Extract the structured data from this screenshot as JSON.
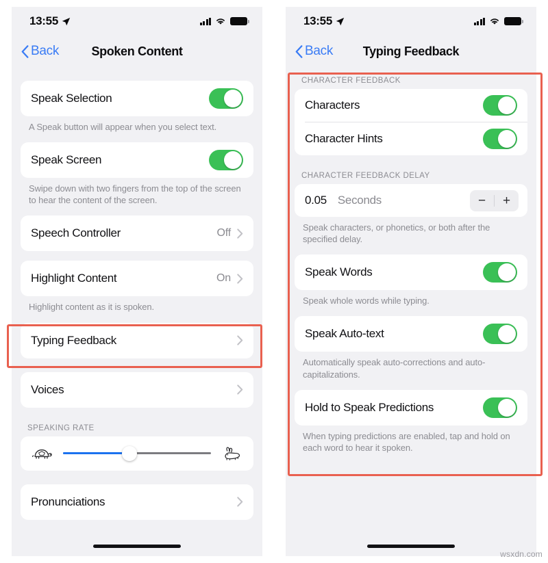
{
  "watermark": "wsxdn.com",
  "left_screen": {
    "status_bar": {
      "time": "13:55",
      "location_icon": "location-arrow-icon",
      "signal_icon": "cellular-signal-icon",
      "wifi_icon": "wifi-icon",
      "battery_icon": "battery-full-icon"
    },
    "nav": {
      "back_label": "Back",
      "title": "Spoken Content",
      "back_icon": "chevron-left-icon"
    },
    "rows": [
      {
        "type": "toggle",
        "label": "Speak Selection",
        "state": "on",
        "footnote": "A Speak button will appear when you select text."
      },
      {
        "type": "toggle",
        "label": "Speak Screen",
        "state": "on",
        "footnote": "Swipe down with two fingers from the top of the screen to hear the content of the screen."
      },
      {
        "type": "link",
        "label": "Speech Controller",
        "value": "Off",
        "footnote": ""
      },
      {
        "type": "link",
        "label": "Highlight Content",
        "value": "On",
        "footnote": "Highlight content as it is spoken."
      },
      {
        "type": "link",
        "label": "Typing Feedback",
        "value": "",
        "footnote": "",
        "highlighted": true
      },
      {
        "type": "link",
        "label": "Voices",
        "value": "",
        "footnote": ""
      }
    ],
    "speaking_rate": {
      "header": "SPEAKING RATE",
      "slow_icon": "turtle-icon",
      "fast_icon": "rabbit-icon",
      "value_percent": 45
    },
    "pronunciations": {
      "label": "Pronunciations"
    }
  },
  "right_screen": {
    "status_bar": {
      "time": "13:55",
      "location_icon": "location-arrow-icon",
      "signal_icon": "cellular-signal-icon",
      "wifi_icon": "wifi-icon",
      "battery_icon": "battery-full-icon"
    },
    "nav": {
      "back_label": "Back",
      "title": "Typing Feedback",
      "back_icon": "chevron-left-icon"
    },
    "character_feedback": {
      "header": "CHARACTER FEEDBACK",
      "rows": [
        {
          "label": "Characters",
          "state": "on"
        },
        {
          "label": "Character Hints",
          "state": "on"
        }
      ]
    },
    "character_feedback_delay": {
      "header": "CHARACTER FEEDBACK DELAY",
      "value": "0.05",
      "unit": "Seconds",
      "minus_label": "−",
      "plus_label": "+",
      "footnote": "Speak characters, or phonetics, or both after the specified delay."
    },
    "speak_words": {
      "label": "Speak Words",
      "state": "on",
      "footnote": "Speak whole words while typing."
    },
    "speak_auto_text": {
      "label": "Speak Auto-text",
      "state": "on",
      "footnote": "Automatically speak auto-corrections and auto-capitalizations."
    },
    "hold_to_speak": {
      "label": "Hold to Speak Predictions",
      "state": "on",
      "footnote": "When typing predictions are enabled, tap and hold on each word to hear it spoken."
    }
  },
  "colors": {
    "toggle_on": "#3ac056",
    "accent_blue": "#3a7cf5",
    "slider_fill": "#1b72ef",
    "highlight_red": "#e9604f",
    "background": "#f1f1f4"
  }
}
